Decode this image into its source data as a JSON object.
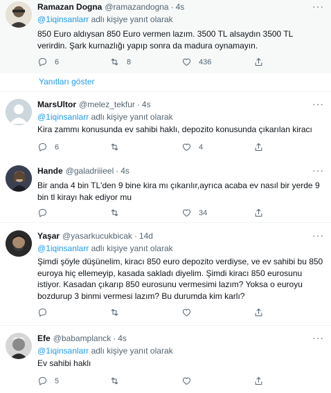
{
  "reply_prefix": "adlı kişiye yanıt olarak",
  "show_replies": "Yanıtları göster",
  "tweets": [
    {
      "name": "Ramazan Dogna",
      "handle": "@ramazandogna",
      "time": "4s",
      "reply_to": "@1iqinsanlarr",
      "text": "850 Euro aldıysan 850 Euro vermen lazım. 3500 TL alsaydın 3500 TL verirdin. Şark kurnazlığı yapıp sonra da madura oynamayın.",
      "replies": "6",
      "retweets": "8",
      "likes": "436"
    },
    {
      "name": "MarsUltor",
      "handle": "@melez_tekfur",
      "time": "4s",
      "reply_to": "@1iqinsanlarr",
      "text": "Kira zammı konusunda ev sahibi haklı, depozito konusunda çıkarılan kiracı",
      "replies": "6",
      "retweets": "",
      "likes": "4"
    },
    {
      "name": "Hande",
      "handle": "@galadriiieel",
      "time": "4s",
      "reply_to": "",
      "text": "Bir anda 4 bin TL'den 9 bine kira mı çıkarılır,ayrıca acaba ev nasıl bir yerde 9 bin tl kirayı hak ediyor mu",
      "replies": "",
      "retweets": "",
      "likes": "34"
    },
    {
      "name": "Yaşar",
      "handle": "@yasarkucukbicak",
      "time": "14d",
      "reply_to": "@1iqinsanlarr",
      "text": "Şimdi şöyle düşünelim, kiracı 850 euro depozito verdiyse, ve ev sahibi bu 850 euroya hiç ellemeyip, kasada sakladı diyelim. Şimdi kiracı 850 eurosunu istiyor. Kasadan çıkarıp 850 eurosunu vermesimi lazım? Yoksa o euroyu bozdurup 3 binmi vermesi lazım? Bu durumda kim karlı?",
      "replies": "",
      "retweets": "",
      "likes": ""
    },
    {
      "name": "Efe",
      "handle": "@babamplanck",
      "time": "4s",
      "reply_to": "@1iqinsanlarr",
      "text": "Ev sahibi haklı",
      "replies": "5",
      "retweets": "",
      "likes": ""
    }
  ]
}
